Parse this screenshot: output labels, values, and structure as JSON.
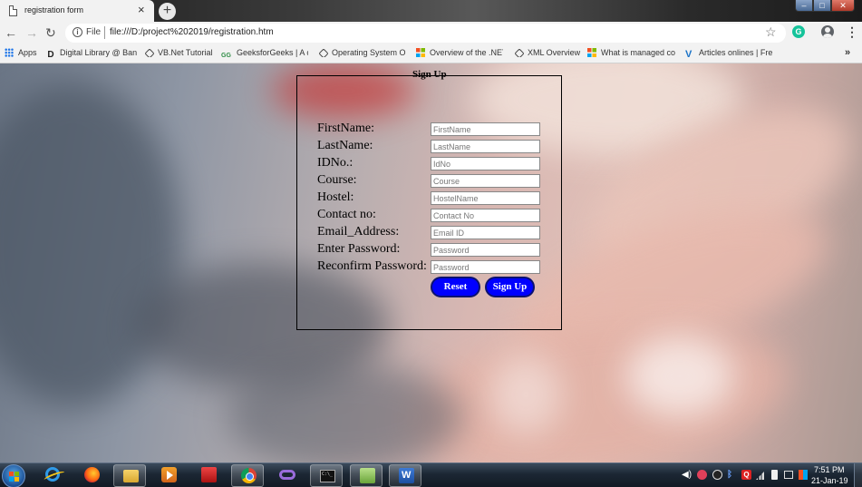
{
  "browser": {
    "tab_title": "registration form",
    "tab_close": "×",
    "new_tab": "+",
    "window_controls": {
      "minimize": "–",
      "maximize": "□",
      "close": "✕"
    },
    "nav": {
      "back": "←",
      "forward": "→",
      "reload": "↻"
    },
    "address": {
      "scheme_label": "File",
      "url": "file:///D:/project%202019/registration.htm"
    },
    "bookmarks": [
      {
        "label": "Apps",
        "icon": "apps-grid-icon"
      },
      {
        "label": "Digital Library @ Ban",
        "icon": "d-logo-icon"
      },
      {
        "label": "VB.Net Tutorial",
        "icon": "vb-diamond-icon"
      },
      {
        "label": "GeeksforGeeks | A co",
        "icon": "gfg-icon"
      },
      {
        "label": "Operating System O",
        "icon": "os-diamond-icon"
      },
      {
        "label": "Overview of the .NET",
        "icon": "windows-logo-icon"
      },
      {
        "label": "XML Overview",
        "icon": "xml-diamond-icon"
      },
      {
        "label": "What is managed co",
        "icon": "windows-logo-icon"
      },
      {
        "label": "Articles onlines | Free",
        "icon": "v-logo-icon"
      }
    ],
    "bookmarks_more": "»"
  },
  "form": {
    "legend": "Sign Up",
    "fields": [
      {
        "label": "FirstName:",
        "placeholder": "FirstName"
      },
      {
        "label": "LastName:",
        "placeholder": "LastName"
      },
      {
        "label": "IDNo.:",
        "placeholder": "IdNo"
      },
      {
        "label": "Course:",
        "placeholder": "Course"
      },
      {
        "label": "Hostel:",
        "placeholder": "HostelName"
      },
      {
        "label": "Contact no:",
        "placeholder": "Contact No"
      },
      {
        "label": "Email_Address:",
        "placeholder": "Email ID"
      },
      {
        "label": "Enter Password:",
        "placeholder": "Password"
      },
      {
        "label": "Reconfirm Password:",
        "placeholder": "Password"
      }
    ],
    "buttons": {
      "reset": "Reset",
      "submit": "Sign Up"
    },
    "button_color": "#0000ff"
  },
  "taskbar": {
    "clock_time": "7:51 PM",
    "clock_date": "21-Jan-19",
    "apps": [
      "internet-explorer",
      "firefox",
      "file-explorer",
      "media-player",
      "app-tb5",
      "chrome",
      "visual-studio",
      "command-prompt",
      "notepad",
      "word"
    ]
  }
}
